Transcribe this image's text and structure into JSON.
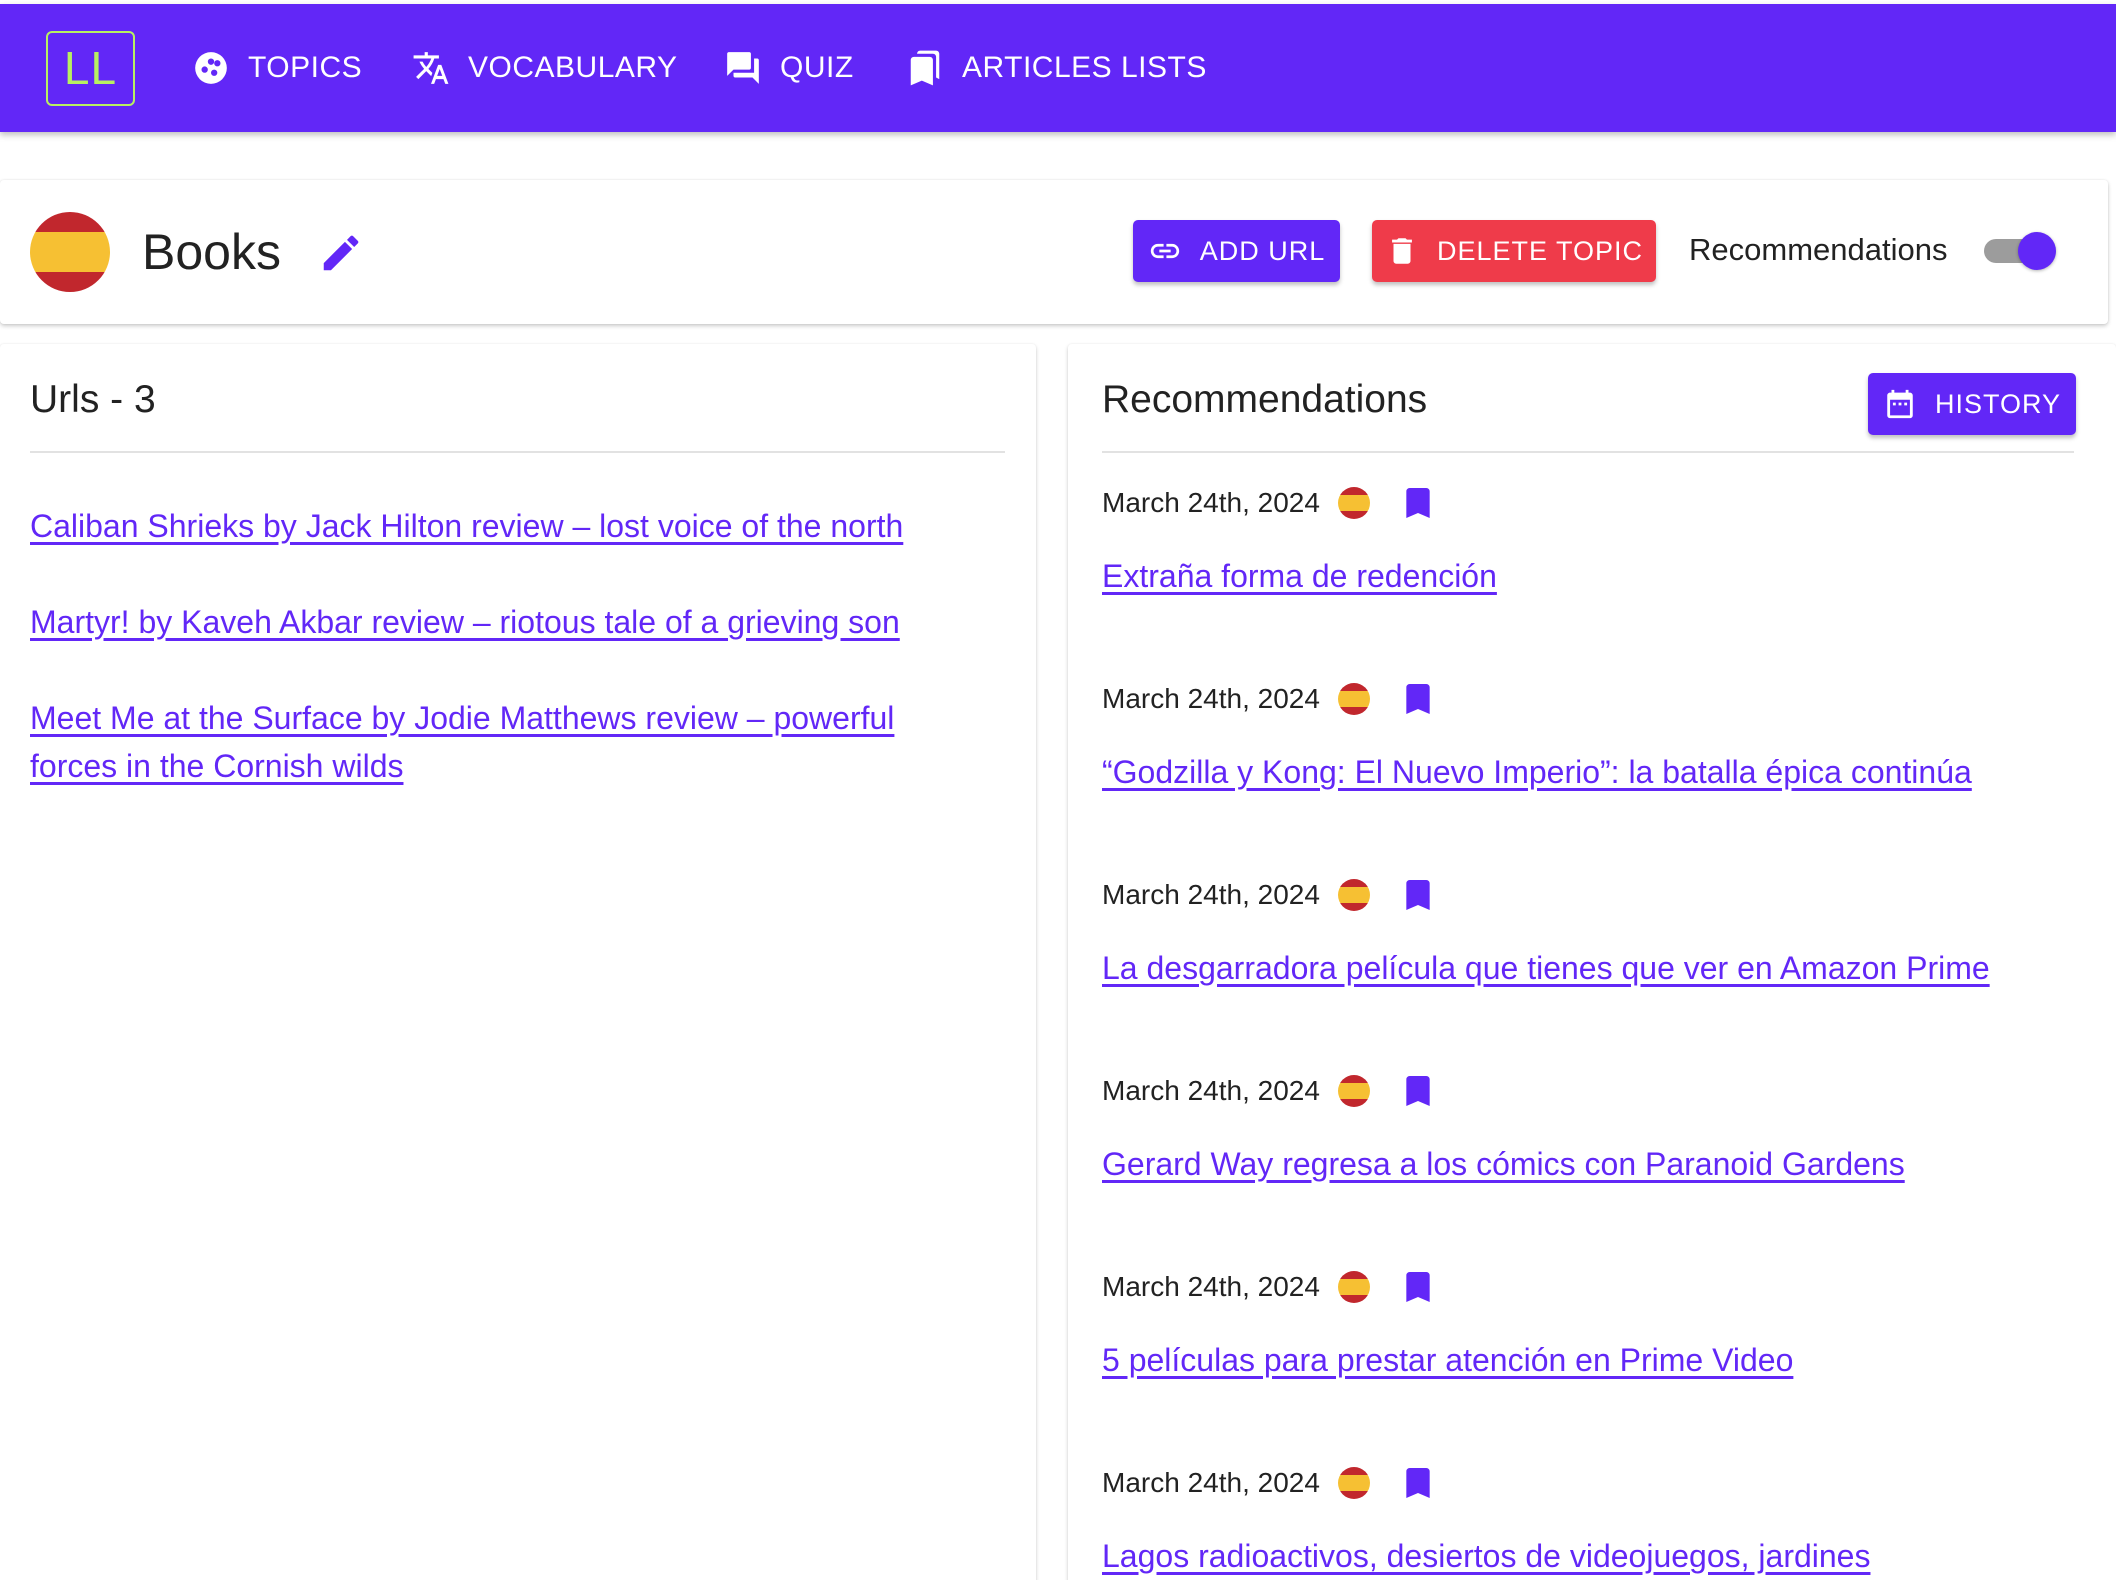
{
  "brand": {
    "logo_text": "LL",
    "accent": "#6227f7",
    "logo_color": "#b8f061"
  },
  "nav": {
    "topics": {
      "label": "TOPICS",
      "icon": "topics-icon"
    },
    "vocabulary": {
      "label": "VOCABULARY",
      "icon": "translate-icon"
    },
    "quiz": {
      "label": "QUIZ",
      "icon": "chat-icon"
    },
    "articles": {
      "label": "ARTICLES LISTS",
      "icon": "bookmarks-icon"
    }
  },
  "topic": {
    "title": "Books",
    "flag": "spain-flag",
    "add_url_label": "ADD URL",
    "delete_label": "DELETE TOPIC",
    "delete_color": "#ef3b4a",
    "recommendations_label": "Recommendations",
    "recommendations_enabled": true
  },
  "urls": {
    "title": "Urls - 3",
    "items": [
      "Caliban Shrieks by Jack Hilton review – lost voice of the north",
      "Martyr! by Kaveh Akbar review – riotous tale of a grieving son",
      "Meet Me at the Surface by Jodie Matthews review – powerful forces in the Cornish wilds"
    ]
  },
  "recommendations": {
    "title": "Recommendations",
    "history_label": "HISTORY",
    "items": [
      {
        "date": "March 24th, 2024",
        "title": "Extraña forma de redención"
      },
      {
        "date": "March 24th, 2024",
        "title": "“Godzilla y Kong: El Nuevo Imperio”: la batalla épica continúa"
      },
      {
        "date": "March 24th, 2024",
        "title": "La desgarradora película que tienes que ver en Amazon Prime"
      },
      {
        "date": "March 24th, 2024",
        "title": "Gerard Way regresa a los cómics con Paranoid Gardens"
      },
      {
        "date": "March 24th, 2024",
        "title": "5 películas para prestar atención en Prime Video"
      },
      {
        "date": "March 24th, 2024",
        "title": "Lagos radioactivos, desiertos de videojuegos, jardines"
      }
    ]
  }
}
